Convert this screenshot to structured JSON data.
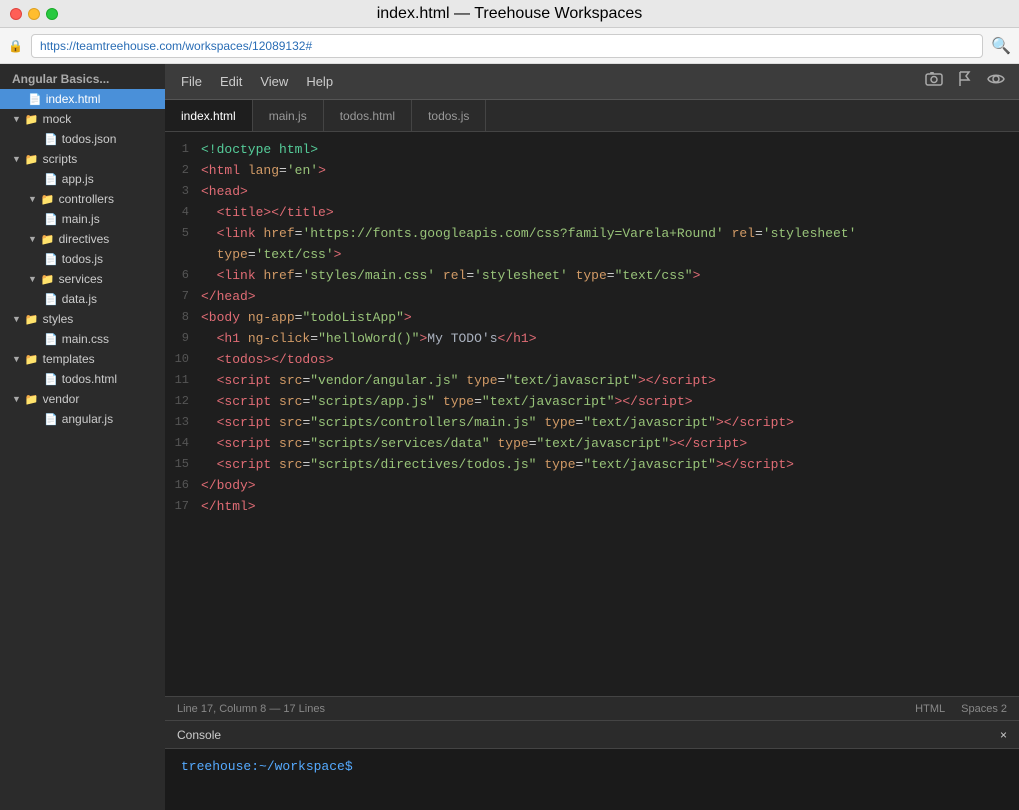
{
  "window": {
    "title": "index.html — Treehouse Workspaces",
    "url": "https://teamtreehouse.com/workspaces/12089132#"
  },
  "toolbar": {
    "file_label": "File",
    "edit_label": "Edit",
    "view_label": "View",
    "help_label": "Help"
  },
  "tabs": [
    {
      "label": "index.html",
      "active": true
    },
    {
      "label": "main.js",
      "active": false
    },
    {
      "label": "todos.html",
      "active": false
    },
    {
      "label": "todos.js",
      "active": false
    }
  ],
  "sidebar": {
    "project_label": "Angular Basics...",
    "items": [
      {
        "id": "index-html",
        "label": "index.html",
        "type": "file",
        "indent": 1,
        "active": true
      },
      {
        "id": "mock",
        "label": "mock",
        "type": "folder",
        "indent": 1,
        "open": true
      },
      {
        "id": "todos-json",
        "label": "todos.json",
        "type": "file",
        "indent": 2
      },
      {
        "id": "scripts",
        "label": "scripts",
        "type": "folder",
        "indent": 1,
        "open": true
      },
      {
        "id": "app-js",
        "label": "app.js",
        "type": "file",
        "indent": 2
      },
      {
        "id": "controllers",
        "label": "controllers",
        "type": "folder",
        "indent": 2,
        "open": true
      },
      {
        "id": "main-js",
        "label": "main.js",
        "type": "file",
        "indent": 3
      },
      {
        "id": "directives",
        "label": "directives",
        "type": "folder",
        "indent": 2,
        "open": true
      },
      {
        "id": "todos-js",
        "label": "todos.js",
        "type": "file",
        "indent": 3
      },
      {
        "id": "services",
        "label": "services",
        "type": "folder",
        "indent": 2,
        "open": true
      },
      {
        "id": "data-js",
        "label": "data.js",
        "type": "file",
        "indent": 3
      },
      {
        "id": "styles",
        "label": "styles",
        "type": "folder",
        "indent": 1,
        "open": true
      },
      {
        "id": "main-css",
        "label": "main.css",
        "type": "file",
        "indent": 2
      },
      {
        "id": "templates",
        "label": "templates",
        "type": "folder",
        "indent": 1,
        "open": true
      },
      {
        "id": "todos-html",
        "label": "todos.html",
        "type": "file",
        "indent": 2
      },
      {
        "id": "vendor",
        "label": "vendor",
        "type": "folder",
        "indent": 1,
        "open": true
      },
      {
        "id": "angular-js",
        "label": "angular.js",
        "type": "file",
        "indent": 2
      }
    ]
  },
  "code_lines": [
    {
      "num": 1,
      "html": "<span class='doctype'>&lt;!doctype html&gt;</span>"
    },
    {
      "num": 2,
      "html": "<span class='tag'>&lt;html</span> <span class='attr-name'>lang</span>=<span class='attr-value'>'en'</span><span class='tag'>&gt;</span>"
    },
    {
      "num": 3,
      "html": "<span class='tag'>&lt;head&gt;</span>"
    },
    {
      "num": 4,
      "html": "  <span class='tag'>&lt;title&gt;&lt;/title&gt;</span>"
    },
    {
      "num": 5,
      "html": "  <span class='tag'>&lt;link</span> <span class='attr-name'>href</span>=<span class='attr-value'>'https://fonts.googleapis.com/css?family=Varela+Round'</span> <span class='attr-name'>rel</span>=<span class='attr-value'>'stylesheet'</span><br>  <span class='attr-name'>type</span>=<span class='attr-value'>'text/css'</span><span class='tag'>&gt;</span>"
    },
    {
      "num": 6,
      "html": "  <span class='tag'>&lt;link</span> <span class='attr-name'>href</span>=<span class='attr-value'>'styles/main.css'</span> <span class='attr-name'>rel</span>=<span class='attr-value'>'stylesheet'</span> <span class='attr-name'>type</span>=<span class='attr-value'>\"text/css\"</span><span class='tag'>&gt;</span>"
    },
    {
      "num": 7,
      "html": "<span class='tag'>&lt;/head&gt;</span>"
    },
    {
      "num": 8,
      "html": "<span class='tag'>&lt;body</span> <span class='attr-name'>ng-app</span>=<span class='attr-value'>\"todoListApp\"</span><span class='tag'>&gt;</span>"
    },
    {
      "num": 9,
      "html": "  <span class='tag'>&lt;h1</span> <span class='attr-name'>ng-click</span>=<span class='attr-value'>\"helloWord()\"</span><span class='tag'>&gt;</span><span class='text-content'>My TODO's</span><span class='tag'>&lt;/h1&gt;</span>"
    },
    {
      "num": 10,
      "html": "  <span class='tag'>&lt;todos&gt;&lt;/todos&gt;</span>"
    },
    {
      "num": 11,
      "html": "  <span class='tag'>&lt;script</span> <span class='attr-name'>src</span>=<span class='attr-value'>\"vendor/angular.js\"</span> <span class='attr-name'>type</span>=<span class='attr-value'>\"text/javascript\"</span><span class='tag'>&gt;&lt;/script&gt;</span>"
    },
    {
      "num": 12,
      "html": "  <span class='tag'>&lt;script</span> <span class='attr-name'>src</span>=<span class='attr-value'>\"scripts/app.js\"</span> <span class='attr-name'>type</span>=<span class='attr-value'>\"text/javascript\"</span><span class='tag'>&gt;&lt;/script&gt;</span>"
    },
    {
      "num": 13,
      "html": "  <span class='tag'>&lt;script</span> <span class='attr-name'>src</span>=<span class='attr-value'>\"scripts/controllers/main.js\"</span> <span class='attr-name'>type</span>=<span class='attr-value'>\"text/javascript\"</span><span class='tag'>&gt;&lt;/script&gt;</span>"
    },
    {
      "num": 14,
      "html": "  <span class='tag'>&lt;script</span> <span class='attr-name'>src</span>=<span class='attr-value'>\"scripts/services/data\"</span> <span class='attr-name'>type</span>=<span class='attr-value'>\"text/javascript\"</span><span class='tag'>&gt;&lt;/script&gt;</span>"
    },
    {
      "num": 15,
      "html": "  <span class='tag'>&lt;script</span> <span class='attr-name'>src</span>=<span class='attr-value'>\"scripts/directives/todos.js\"</span> <span class='attr-name'>type</span>=<span class='attr-value'>\"text/javascript\"</span><span class='tag'>&gt;&lt;/script&gt;</span>"
    },
    {
      "num": 16,
      "html": "<span class='tag'>&lt;/body&gt;</span>"
    },
    {
      "num": 17,
      "html": "<span class='tag'>&lt;/html&gt;</span>"
    }
  ],
  "statusbar": {
    "position": "Line 17, Column 8 — 17 Lines",
    "language": "HTML",
    "spaces": "Spaces  2"
  },
  "console": {
    "label": "Console",
    "close_label": "×",
    "prompt": "treehouse:~/workspace$"
  }
}
